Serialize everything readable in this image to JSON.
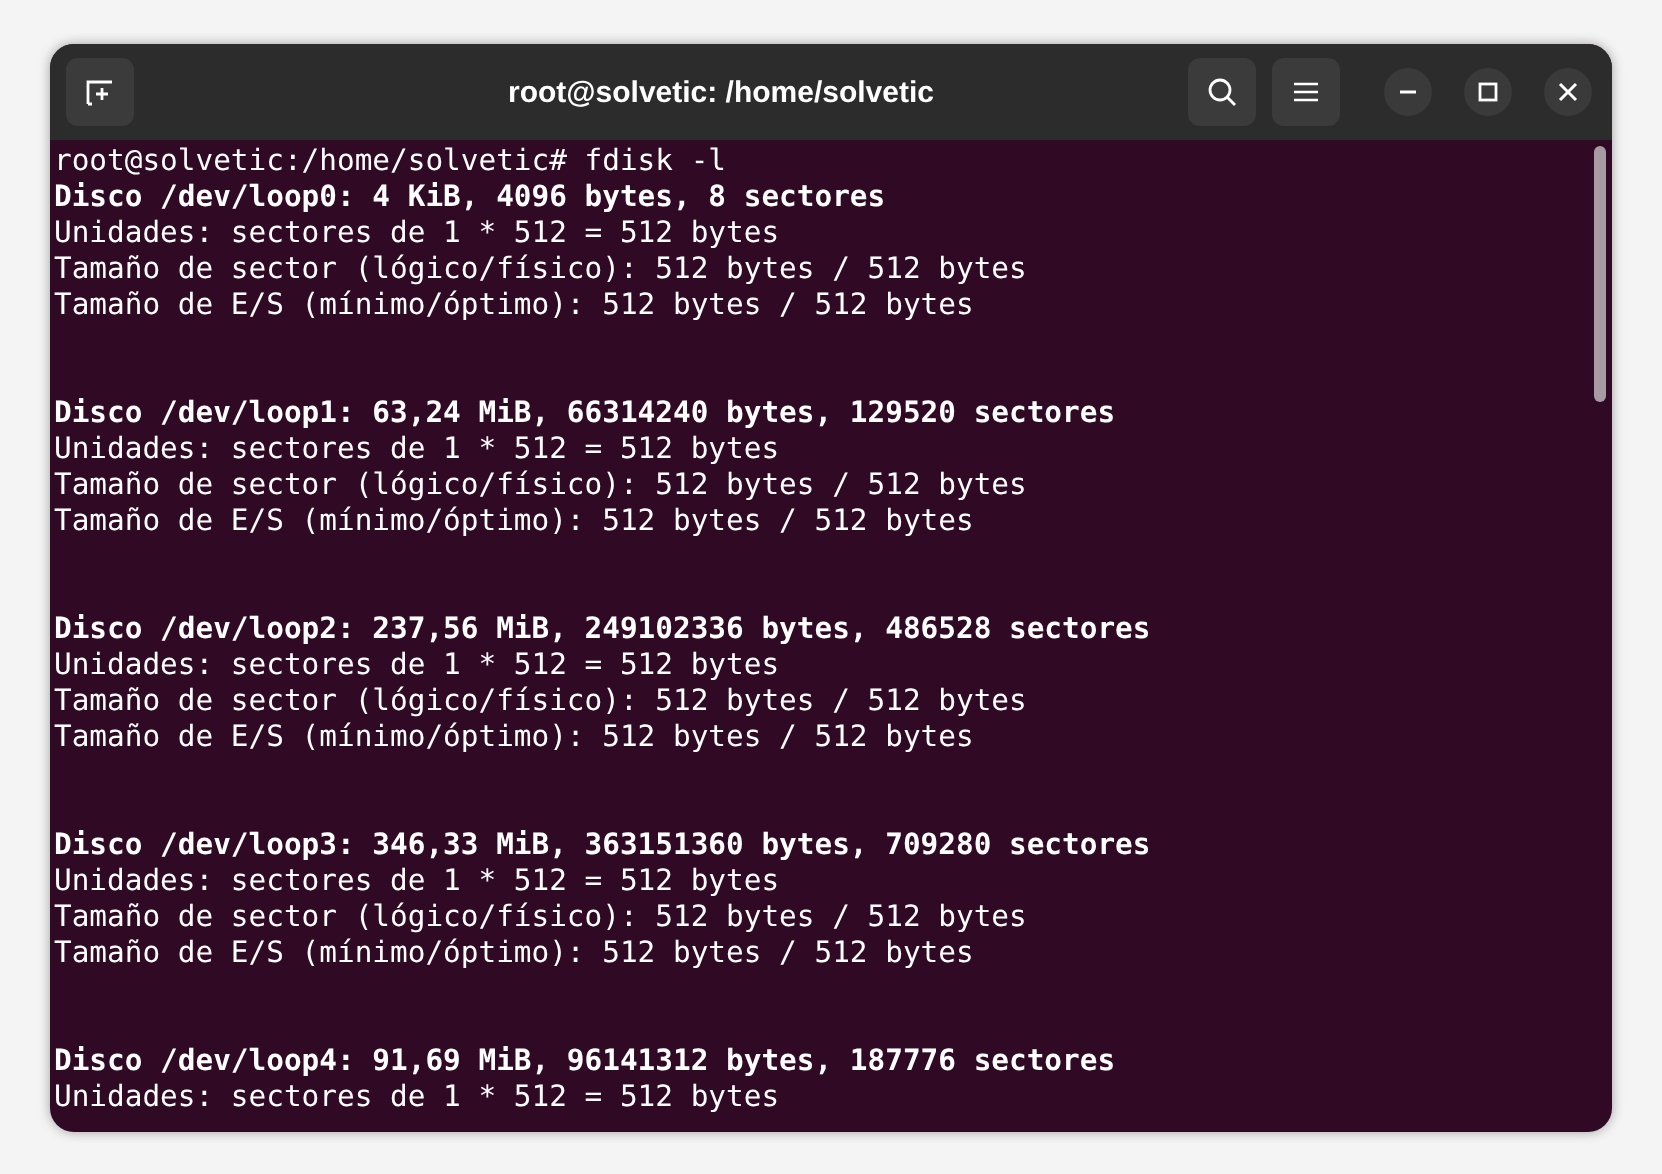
{
  "window": {
    "title": "root@solvetic: /home/solvetic"
  },
  "terminal": {
    "prompt": "root@solvetic:/home/solvetic# fdisk -l",
    "disks": [
      {
        "heading": "Disco /dev/loop0: 4 KiB, 4096 bytes, 8 sectores",
        "lines": [
          "Unidades: sectores de 1 * 512 = 512 bytes",
          "Tamaño de sector (lógico/físico): 512 bytes / 512 bytes",
          "Tamaño de E/S (mínimo/óptimo): 512 bytes / 512 bytes"
        ]
      },
      {
        "heading": "Disco /dev/loop1: 63,24 MiB, 66314240 bytes, 129520 sectores",
        "lines": [
          "Unidades: sectores de 1 * 512 = 512 bytes",
          "Tamaño de sector (lógico/físico): 512 bytes / 512 bytes",
          "Tamaño de E/S (mínimo/óptimo): 512 bytes / 512 bytes"
        ]
      },
      {
        "heading": "Disco /dev/loop2: 237,56 MiB, 249102336 bytes, 486528 sectores",
        "lines": [
          "Unidades: sectores de 1 * 512 = 512 bytes",
          "Tamaño de sector (lógico/físico): 512 bytes / 512 bytes",
          "Tamaño de E/S (mínimo/óptimo): 512 bytes / 512 bytes"
        ]
      },
      {
        "heading": "Disco /dev/loop3: 346,33 MiB, 363151360 bytes, 709280 sectores",
        "lines": [
          "Unidades: sectores de 1 * 512 = 512 bytes",
          "Tamaño de sector (lógico/físico): 512 bytes / 512 bytes",
          "Tamaño de E/S (mínimo/óptimo): 512 bytes / 512 bytes"
        ]
      },
      {
        "heading": "Disco /dev/loop4: 91,69 MiB, 96141312 bytes, 187776 sectores",
        "lines": [
          "Unidades: sectores de 1 * 512 = 512 bytes"
        ]
      }
    ]
  }
}
